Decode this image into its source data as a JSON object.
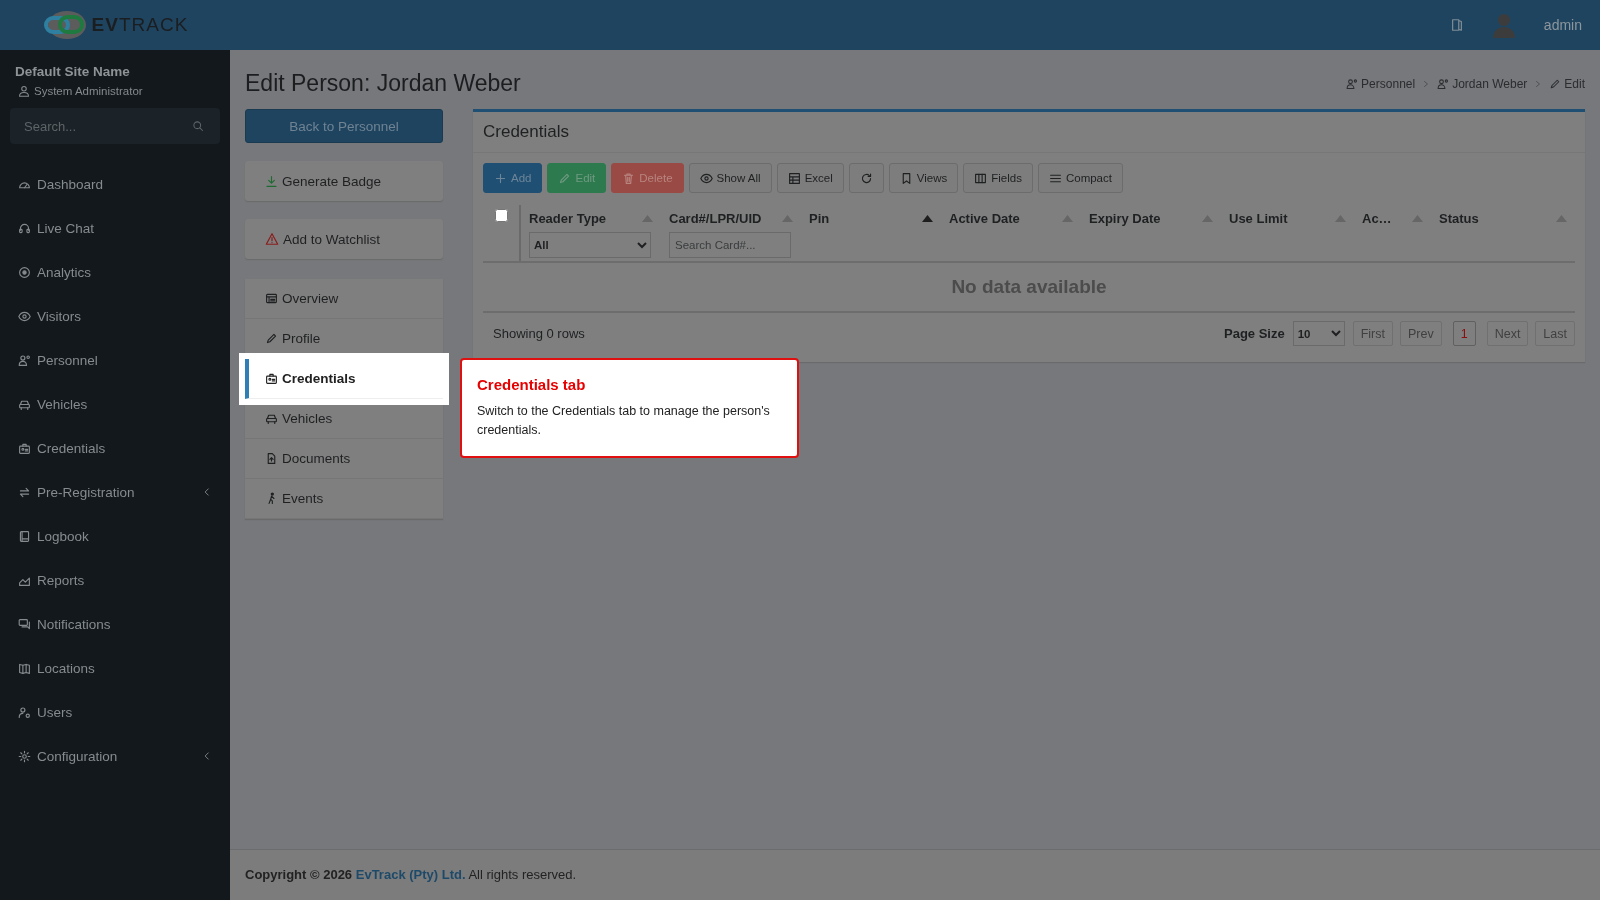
{
  "header": {
    "logo": {
      "bold": "EV",
      "light": "TRACK"
    },
    "user": "admin"
  },
  "sidebar": {
    "site_name": "Default Site Name",
    "role": "System Administrator",
    "search": {
      "placeholder": "Search..."
    },
    "items": [
      {
        "label": "Dashboard",
        "expandable": false
      },
      {
        "label": "Live Chat",
        "expandable": false
      },
      {
        "label": "Analytics",
        "expandable": false
      },
      {
        "label": "Visitors",
        "expandable": false
      },
      {
        "label": "Personnel",
        "expandable": false
      },
      {
        "label": "Vehicles",
        "expandable": false
      },
      {
        "label": "Credentials",
        "expandable": false
      },
      {
        "label": "Pre-Registration",
        "expandable": true
      },
      {
        "label": "Logbook",
        "expandable": false
      },
      {
        "label": "Reports",
        "expandable": false
      },
      {
        "label": "Notifications",
        "expandable": false
      },
      {
        "label": "Locations",
        "expandable": false
      },
      {
        "label": "Users",
        "expandable": false
      },
      {
        "label": "Configuration",
        "expandable": true
      }
    ]
  },
  "page": {
    "title": "Edit Person: Jordan Weber",
    "breadcrumbs": [
      {
        "label": "Personnel"
      },
      {
        "label": "Jordan Weber"
      },
      {
        "label": "Edit"
      }
    ],
    "actions": [
      {
        "label": "Back to Personnel",
        "kind": "primary"
      },
      {
        "label": "Generate Badge",
        "kind": "badge"
      },
      {
        "label": "Add to Watchlist",
        "kind": "watchlist"
      }
    ],
    "tabs": [
      {
        "label": "Overview",
        "selected": false
      },
      {
        "label": "Profile",
        "selected": false
      },
      {
        "label": "Credentials",
        "selected": true
      },
      {
        "label": "Vehicles",
        "selected": false
      },
      {
        "label": "Documents",
        "selected": false
      },
      {
        "label": "Events",
        "selected": false
      }
    ]
  },
  "card": {
    "title": "Credentials",
    "toolbar": [
      {
        "label": "Add",
        "kind": "add"
      },
      {
        "label": "Edit",
        "kind": "edit"
      },
      {
        "label": "Delete",
        "kind": "delete"
      },
      {
        "label": "Show All",
        "kind": "show"
      },
      {
        "label": "Excel",
        "kind": "excel"
      },
      {
        "kind": "refresh"
      },
      {
        "label": "Views",
        "kind": "views"
      },
      {
        "label": "Fields",
        "kind": "fields"
      },
      {
        "label": "Compact",
        "kind": "compact"
      }
    ],
    "select_all": {
      "checked": false
    },
    "columns": [
      {
        "label": "Reader Type",
        "sorted": false,
        "filter": {
          "kind": "select",
          "value": "All"
        }
      },
      {
        "label": "Card#/LPR/UID",
        "sorted": false,
        "filter": {
          "kind": "text",
          "placeholder": "Search Card#..."
        }
      },
      {
        "label": "Pin",
        "sorted": true
      },
      {
        "label": "Active Date",
        "sorted": false
      },
      {
        "label": "Expiry Date",
        "sorted": false
      },
      {
        "label": "Use Limit",
        "sorted": false
      },
      {
        "label": "Ac…",
        "sorted": false
      },
      {
        "label": "Status",
        "sorted": false
      }
    ],
    "empty_text": "No data available",
    "row_count": "Showing 0 rows",
    "page_size": {
      "label": "Page Size",
      "value": "10"
    },
    "pager": [
      {
        "label": "First",
        "selected": false
      },
      {
        "label": "Prev",
        "selected": false
      },
      {
        "label": "1",
        "selected": true
      },
      {
        "label": "Next",
        "selected": false
      },
      {
        "label": "Last",
        "selected": false
      }
    ]
  },
  "tooltip": {
    "title": "Credentials tab",
    "text": "Switch to the Credentials tab to manage the person's credentials."
  },
  "footer": {
    "lead": "Copyright © 2026",
    "link": "EvTrack (Pty) Ltd.",
    "tail": "All rights reserved."
  }
}
